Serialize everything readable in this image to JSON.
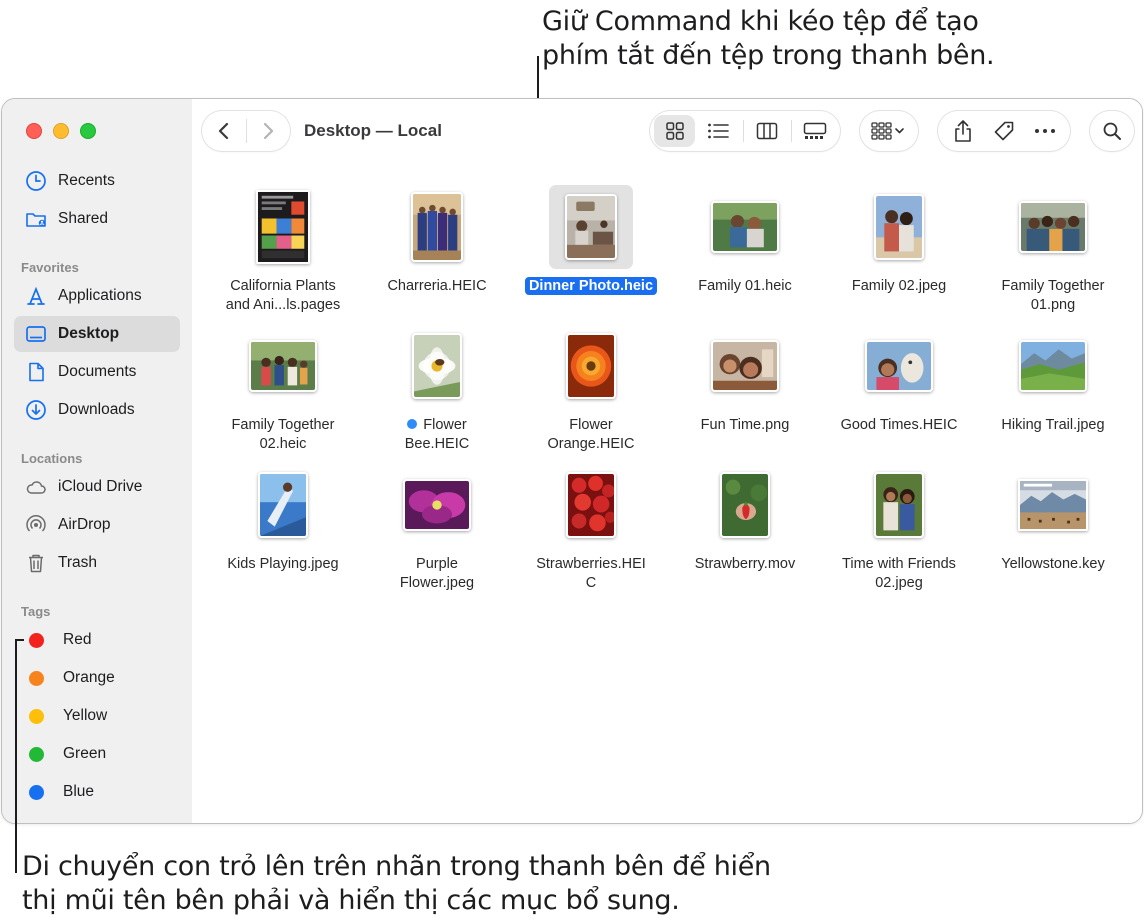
{
  "callouts": {
    "top_line1": "Giữ Command khi kéo tệp để tạo",
    "top_line2": "phím tắt đến tệp trong thanh bên.",
    "bottom_line1": "Di chuyển con trỏ lên trên nhãn trong thanh bên để hiển",
    "bottom_line2": "thị mũi tên bên phải và hiển thị các mục bổ sung."
  },
  "window": {
    "title": "Desktop — Local"
  },
  "sidebar": {
    "recents": "Recents",
    "shared": "Shared",
    "favorites_header": "Favorites",
    "applications": "Applications",
    "desktop": "Desktop",
    "documents": "Documents",
    "downloads": "Downloads",
    "locations_header": "Locations",
    "icloud": "iCloud Drive",
    "airdrop": "AirDrop",
    "trash": "Trash",
    "tags_header": "Tags",
    "tags": [
      {
        "label": "Red",
        "color": "#f2231d"
      },
      {
        "label": "Orange",
        "color": "#f7831d"
      },
      {
        "label": "Yellow",
        "color": "#fdbf09"
      },
      {
        "label": "Green",
        "color": "#22b936"
      },
      {
        "label": "Blue",
        "color": "#1670f0"
      }
    ]
  },
  "toolbar": {
    "icons": [
      "chevron-left-icon",
      "chevron-right-icon",
      "icon-view-icon",
      "list-view-icon",
      "column-view-icon",
      "gallery-view-icon",
      "group-icon",
      "share-icon",
      "tag-icon",
      "more-icon",
      "search-icon"
    ]
  },
  "files": {
    "r1": [
      {
        "line1": "California Plants",
        "line2": "and Ani...ls.pages"
      },
      {
        "line1": "Charreria.HEIC",
        "line2": ""
      },
      {
        "line1": "Dinner Photo.heic",
        "line2": "",
        "selected": true
      },
      {
        "line1": "Family 01.heic",
        "line2": ""
      },
      {
        "line1": "Family 02.jpeg",
        "line2": ""
      },
      {
        "line1": "Family Together",
        "line2": "01.png"
      }
    ],
    "r2": [
      {
        "line1": "Family Together",
        "line2": "02.heic"
      },
      {
        "line1": "Flower",
        "line2": "Bee.HEIC",
        "tag": "blue"
      },
      {
        "line1": "Flower",
        "line2": "Orange.HEIC"
      },
      {
        "line1": "Fun Time.png",
        "line2": ""
      },
      {
        "line1": "Good Times.HEIC",
        "line2": ""
      },
      {
        "line1": "Hiking Trail.jpeg",
        "line2": ""
      }
    ],
    "r3": [
      {
        "line1": "Kids Playing.jpeg",
        "line2": ""
      },
      {
        "line1": "Purple",
        "line2": "Flower.jpeg"
      },
      {
        "line1": "Strawberries.HEI",
        "line2": "C"
      },
      {
        "line1": "Strawberry.mov",
        "line2": ""
      },
      {
        "line1": "Time with Friends",
        "line2": "02.jpeg"
      },
      {
        "line1": "Yellowstone.key",
        "line2": ""
      }
    ]
  }
}
